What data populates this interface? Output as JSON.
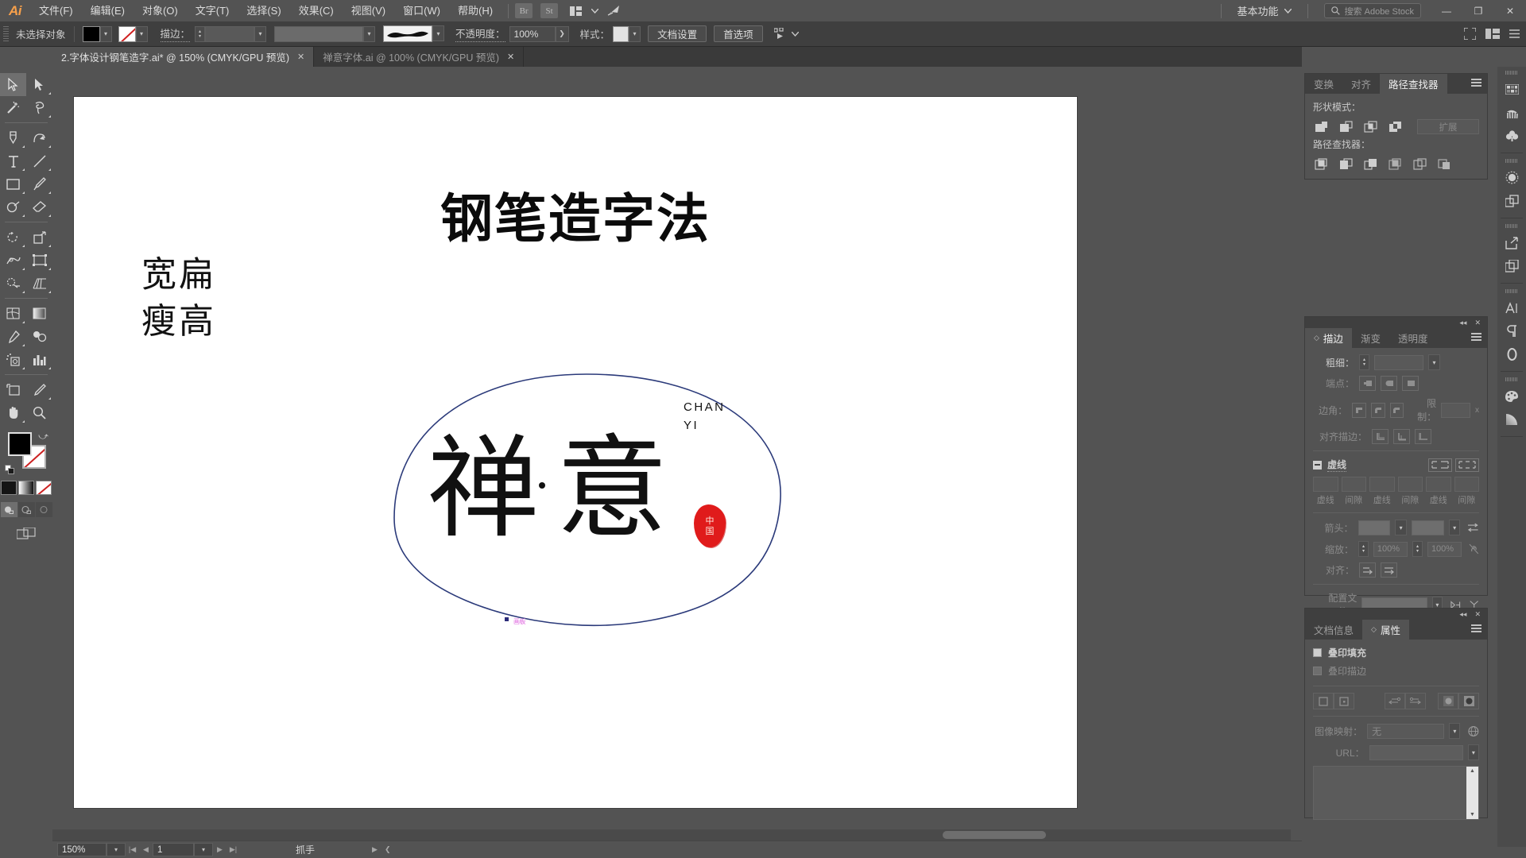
{
  "app": {
    "logo": "Ai",
    "menus": [
      "文件(F)",
      "编辑(E)",
      "对象(O)",
      "文字(T)",
      "选择(S)",
      "效果(C)",
      "视图(V)",
      "窗口(W)",
      "帮助(H)"
    ],
    "quick_buttons": [
      "Br",
      "St"
    ],
    "workspace": "基本功能",
    "search_placeholder": "搜索 Adobe Stock",
    "window_controls": [
      "—",
      "❐",
      "✕"
    ]
  },
  "control_bar": {
    "selection_status": "未选择对象",
    "fill_label": "fill-swatch",
    "stroke_word": "描边：",
    "stroke_weight": "",
    "brush_label": "brush-definition",
    "opacity_label": "不透明度：",
    "opacity_value": "100%",
    "style_label": "样式：",
    "doc_setup": "文档设置",
    "preferences": "首选项",
    "align_label": "align-to-selection"
  },
  "tabs": [
    {
      "title": "2.字体设计钢笔造字.ai* @ 150% (CMYK/GPU 预览)",
      "active": true,
      "close": "✕"
    },
    {
      "title": "禅意字体.ai @ 100% (CMYK/GPU 预览)",
      "active": false,
      "close": "✕"
    }
  ],
  "toolbar": {
    "tools": [
      {
        "name": "selection-tool",
        "active": true
      },
      {
        "name": "direct-selection-tool",
        "active": false
      },
      {
        "name": "magic-wand-tool",
        "active": false
      },
      {
        "name": "lasso-tool",
        "active": false
      },
      {
        "name": "pen-tool",
        "active": false
      },
      {
        "name": "curvature-tool",
        "active": false
      },
      {
        "name": "type-tool",
        "active": false
      },
      {
        "name": "line-segment-tool",
        "active": false
      },
      {
        "name": "rectangle-tool",
        "active": false
      },
      {
        "name": "paintbrush-tool",
        "active": false
      },
      {
        "name": "shaper-tool",
        "active": false
      },
      {
        "name": "eraser-tool",
        "active": false
      },
      {
        "name": "rotate-tool",
        "active": false
      },
      {
        "name": "scale-tool",
        "active": false
      },
      {
        "name": "width-tool",
        "active": false
      },
      {
        "name": "free-transform-tool",
        "active": false
      },
      {
        "name": "shape-builder-tool",
        "active": false
      },
      {
        "name": "perspective-grid-tool",
        "active": false
      },
      {
        "name": "mesh-tool",
        "active": false
      },
      {
        "name": "gradient-tool",
        "active": false
      },
      {
        "name": "eyedropper-tool",
        "active": false
      },
      {
        "name": "blend-tool",
        "active": false
      },
      {
        "name": "symbol-sprayer-tool",
        "active": false
      },
      {
        "name": "column-graph-tool",
        "active": false
      },
      {
        "name": "artboard-tool",
        "active": false
      },
      {
        "name": "slice-tool",
        "active": false
      },
      {
        "name": "hand-tool",
        "active": false
      },
      {
        "name": "zoom-tool",
        "active": false
      }
    ],
    "fill_color": "#000000",
    "stroke_color": "none",
    "modes": [
      "color-mode",
      "gradient-mode",
      "none-mode"
    ],
    "draw_modes": [
      "draw-normal",
      "draw-behind",
      "draw-inside"
    ],
    "screen_mode": "change-screen-mode"
  },
  "artwork": {
    "title": "钢笔造字法",
    "side_lines": [
      "宽扁",
      "瘦高"
    ],
    "zen_left": "禅",
    "zen_right": "意",
    "pinyin": [
      "CHAN",
      "YI"
    ],
    "seal_chars": [
      "中",
      "国"
    ],
    "seal_color": "#e01b1b",
    "path_color": "#2b3a7a",
    "anchor_label": "画板"
  },
  "panels": {
    "pathfinder": {
      "tabs": [
        "变换",
        "对齐",
        "路径查找器"
      ],
      "active_tab": "路径查找器",
      "shape_modes_label": "形状模式：",
      "expand_label": "扩展",
      "pathfinders_label": "路径查找器：",
      "shape_mode_icons": [
        "unite-icon",
        "minus-front-icon",
        "intersect-icon",
        "exclude-icon"
      ],
      "pathfinder_icons": [
        "divide-icon",
        "trim-icon",
        "merge-icon",
        "crop-icon",
        "outline-icon",
        "minus-back-icon"
      ]
    },
    "stroke": {
      "tabs": [
        "描边",
        "渐变",
        "透明度"
      ],
      "active_tab": "描边",
      "weight_label": "粗细：",
      "weight_value": "",
      "cap_label": "端点：",
      "corner_label": "边角：",
      "limit_label": "限制：",
      "limit_unit": "x",
      "align_label": "对齐描边：",
      "dash_label": "虚线",
      "dash_fields": [
        "",
        "",
        "",
        "",
        "",
        ""
      ],
      "dash_field_labels": [
        "虚线",
        "间隙",
        "虚线",
        "间隙",
        "虚线",
        "间隙"
      ],
      "arrow_label": "箭头：",
      "scale_label": "缩放：",
      "scale_values": [
        "100%",
        "100%"
      ],
      "align_arrow_label": "对齐：",
      "profile_label": "配置文件："
    },
    "attributes": {
      "tabs": [
        "文档信息",
        "属性"
      ],
      "active_tab": "属性",
      "overprint_fill": "叠印填充",
      "overprint_stroke": "叠印描边",
      "image_map_label": "图像映射：",
      "image_map_value": "无",
      "url_label": "URL："
    }
  },
  "rail": {
    "icons": [
      "swatches-icon",
      "brushes-icon",
      "symbols-icon",
      "appearance-icon",
      "layers-icon",
      "export-icon",
      "artboards-icon",
      "character-icon",
      "paragraph-icon",
      "glyphs-icon",
      "color-guide-icon",
      "gradient-panel-icon"
    ]
  },
  "status_bar": {
    "zoom": "150%",
    "page": "1",
    "tool_name": "抓手"
  }
}
